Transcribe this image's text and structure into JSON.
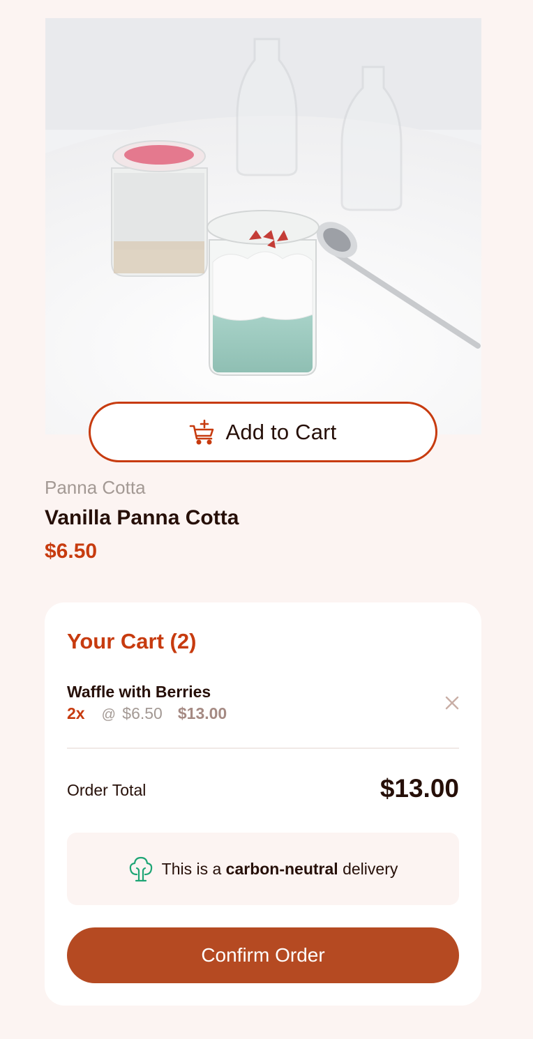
{
  "product": {
    "image_alt": "Vanilla Panna Cotta",
    "add_to_cart_label": "Add to Cart",
    "category": "Panna Cotta",
    "name": "Vanilla Panna Cotta",
    "price": "$6.50"
  },
  "cart": {
    "title": "Your Cart (2)",
    "items": [
      {
        "name": "Waffle with Berries",
        "quantity": "2x",
        "unit_prefix": "@",
        "unit_price": "$6.50",
        "line_total": "$13.00"
      }
    ],
    "order_total_label": "Order Total",
    "order_total_value": "$13.00",
    "carbon_note": {
      "prefix": "This is a",
      "emphasis": "carbon-neutral",
      "suffix": "delivery"
    },
    "confirm_label": "Confirm Order"
  },
  "colors": {
    "page_background": "#fcf4f2",
    "accent": "#c73b0f",
    "confirm_button": "#b54a22",
    "text_dark": "#260f08",
    "text_muted": "#a39994",
    "carbon_icon": "#1ea575"
  },
  "icons": {
    "add_to_cart": "cart-plus-icon",
    "remove_item": "close-icon",
    "carbon_neutral": "tree-icon"
  }
}
